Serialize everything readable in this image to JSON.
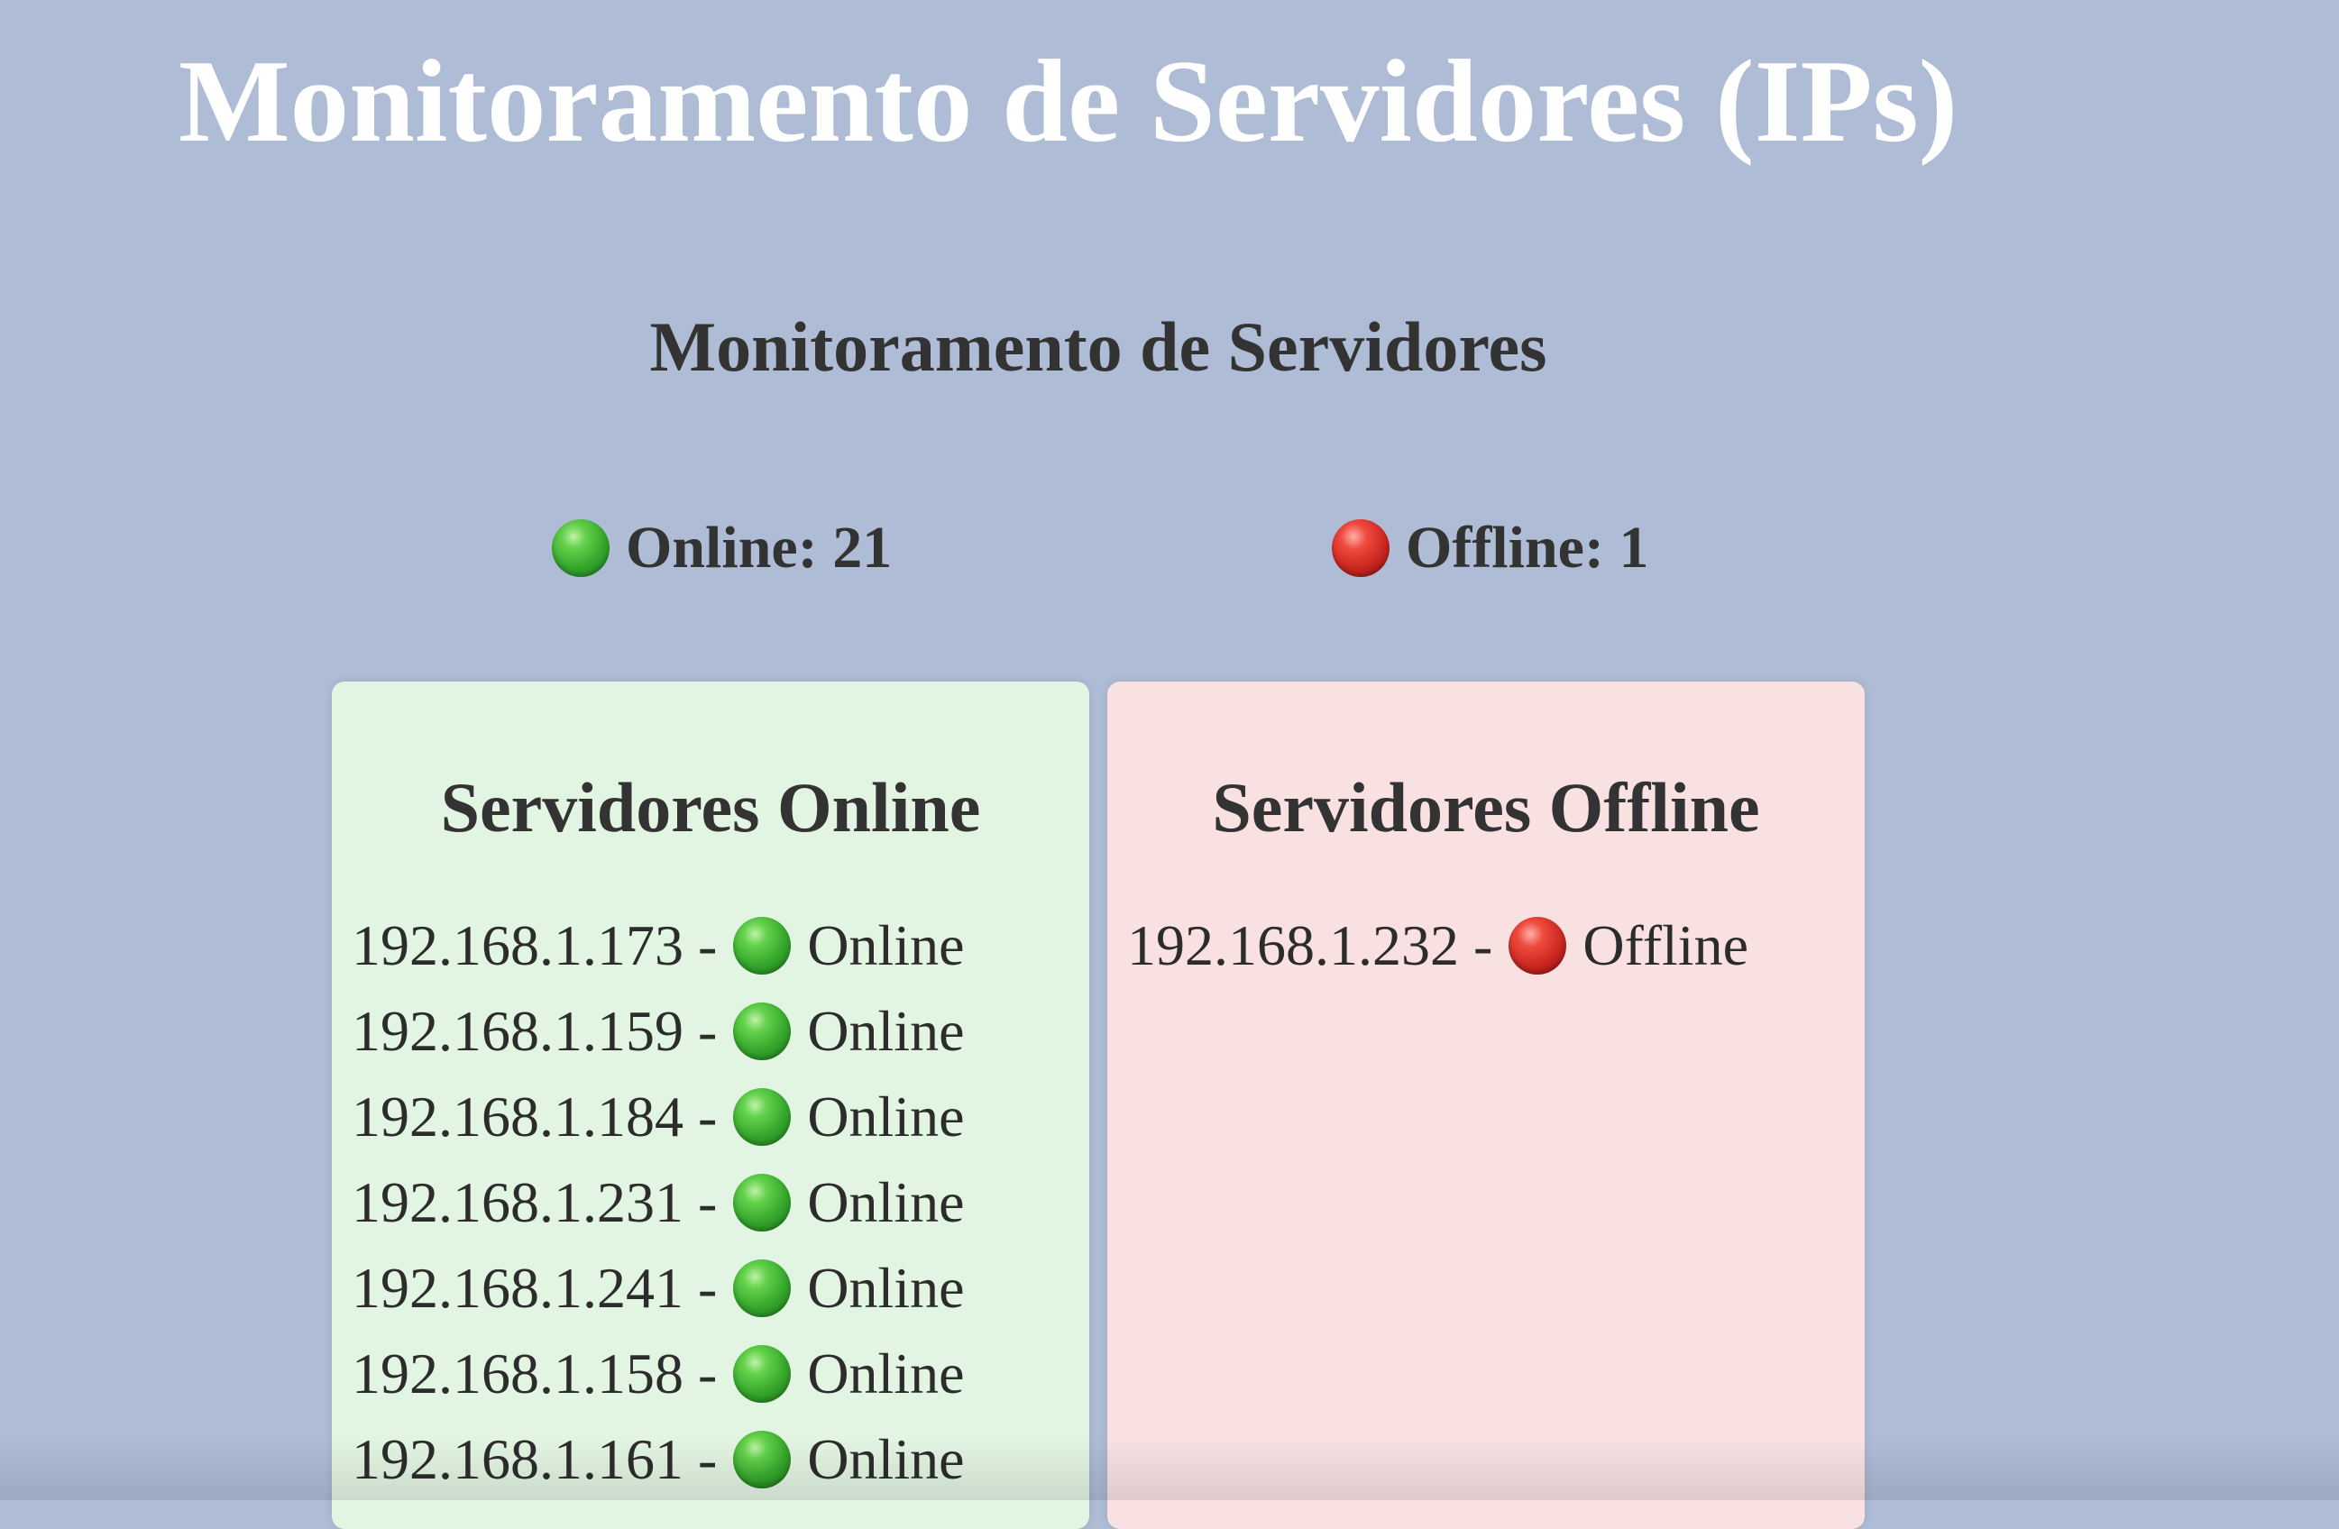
{
  "page": {
    "title": "Monitoramento de Servidores (IPs)",
    "section_title": "Monitoramento de Servidores"
  },
  "summary": {
    "online_text": "Online: 21",
    "offline_text": "Offline: 1",
    "online_icon": "green-circle-icon",
    "offline_icon": "red-circle-icon"
  },
  "panels": {
    "online": {
      "title": "Servidores Online",
      "status_label": "Online",
      "background_color": "#e2f4e2",
      "servers": [
        {
          "ip": "192.168.1.173 -",
          "status": "Online"
        },
        {
          "ip": "192.168.1.159 -",
          "status": "Online"
        },
        {
          "ip": "192.168.1.184 -",
          "status": "Online"
        },
        {
          "ip": "192.168.1.231 -",
          "status": "Online"
        },
        {
          "ip": "192.168.1.241 -",
          "status": "Online"
        },
        {
          "ip": "192.168.1.158 -",
          "status": "Online"
        },
        {
          "ip": "192.168.1.161 -",
          "status": "Online"
        }
      ]
    },
    "offline": {
      "title": "Servidores Offline",
      "status_label": "Offline",
      "background_color": "#f9e1e2",
      "servers": [
        {
          "ip": "192.168.1.232 -",
          "status": "Offline"
        }
      ]
    }
  },
  "colors": {
    "page_background": "#aebcd6",
    "title_text": "#ffffff",
    "body_text": "#333333",
    "online_dot": "#35a62c",
    "offline_dot": "#c9261f"
  }
}
